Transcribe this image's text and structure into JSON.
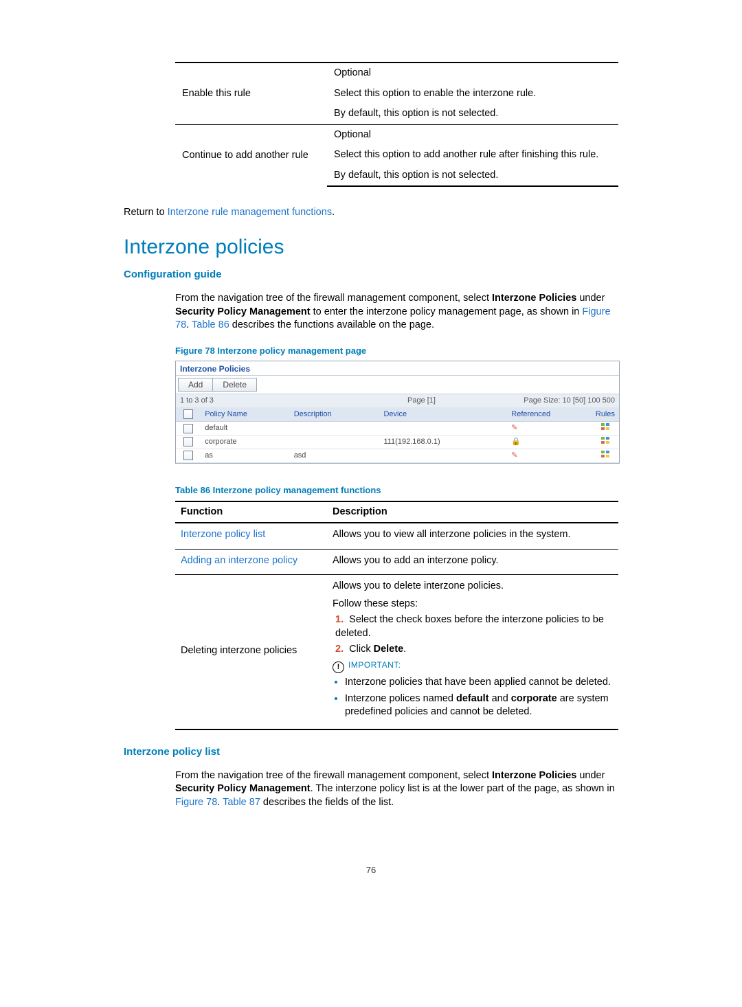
{
  "top_table": {
    "rows": [
      {
        "label": "Enable this rule",
        "lines": [
          "Optional",
          "Select this option to enable the interzone rule.",
          "By default, this option is not selected."
        ]
      },
      {
        "label": "Continue to add another rule",
        "lines": [
          "Optional",
          "Select this option to add another rule after finishing this rule.",
          "By default, this option is not selected."
        ]
      }
    ]
  },
  "return_line": {
    "prefix": "Return to ",
    "link": "Interzone rule management functions",
    "suffix": "."
  },
  "h1": "Interzone policies",
  "config_guide": {
    "heading": "Configuration guide",
    "p1a": "From the navigation tree of the firewall management component, select ",
    "p1b": "Interzone Policies",
    "p1c": " under ",
    "p1d": "Security Policy Management",
    "p1e": " to enter the interzone policy management page, as shown in ",
    "fig_link": "Figure 78",
    "p1f": ". ",
    "tbl_link": "Table 86",
    "p1g": " describes the functions available on the page."
  },
  "figure78": {
    "caption": "Figure 78 Interzone policy management page",
    "title": "Interzone Policies",
    "btn_add": "Add",
    "btn_delete": "Delete",
    "status_left": "1 to 3 of 3",
    "status_mid": "Page [1]",
    "status_right": "Page Size: 10 [50] 100 500",
    "headers": [
      "",
      "Policy Name",
      "Description",
      "Device",
      "Referenced",
      "Rules"
    ],
    "rows": [
      {
        "name": "default",
        "desc": "",
        "device": "",
        "ref": "edit"
      },
      {
        "name": "corporate",
        "desc": "",
        "device": "111(192.168.0.1)",
        "ref": "lock"
      },
      {
        "name": "as",
        "desc": "asd",
        "device": "",
        "ref": "edit"
      }
    ]
  },
  "table86": {
    "caption": "Table 86 Interzone policy management functions",
    "h1": "Function",
    "h2": "Description",
    "row1": {
      "fn": "Interzone policy list",
      "desc": "Allows you to view all interzone policies in the system."
    },
    "row2": {
      "fn": "Adding an interzone policy",
      "desc": "Allows you to add an interzone policy."
    },
    "row3": {
      "fn": "Deleting interzone policies",
      "l1": "Allows you to delete interzone policies.",
      "l2": "Follow these steps:",
      "s1": "Select the check boxes before the interzone policies to be deleted.",
      "s2a": "Click ",
      "s2b": "Delete",
      "s2c": ".",
      "imp": "IMPORTANT:",
      "b1": "Interzone policies that have been applied cannot be deleted.",
      "b2a": "Interzone polices named ",
      "b2b": "default",
      "b2c": " and ",
      "b2d": "corporate",
      "b2e": " are system predefined policies and cannot be deleted."
    }
  },
  "policy_list": {
    "heading": "Interzone policy list",
    "p1a": "From the navigation tree of the firewall management component, select ",
    "p1b": "Interzone Policies",
    "p1c": " under ",
    "p1d": "Security Policy Management",
    "p1e": ". The interzone policy list is at the lower part of the page, as shown in ",
    "fig_link": "Figure 78",
    "p1f": ". ",
    "tbl_link": "Table 87",
    "p1g": " describes the fields of the list."
  },
  "page_number": "76"
}
